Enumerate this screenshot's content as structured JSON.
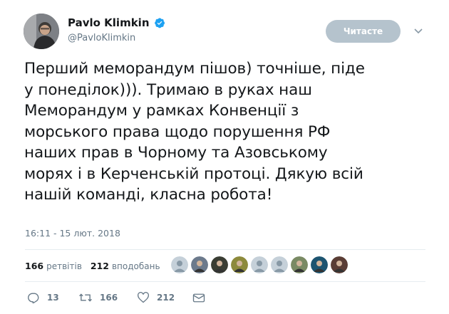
{
  "author": {
    "name": "Pavlo Klimkin",
    "handle": "@PavloKlimkin",
    "verified_icon": "verified-badge-icon"
  },
  "follow_button": {
    "label": "Читасте"
  },
  "tweet": {
    "text": "Перший меморандум пішов) точніше, піде\nу понеділок))). Тримаю в руках наш\nМеморандум у рамках Конвенції з\nморського права щодо порушення РФ\nнаших прав в Чорному та Азовському\nморях і в Керченській протоці. Дякую всій\nнашій команді, класна робота!",
    "timestamp": "16:11 - 15 лют. 2018"
  },
  "stats": {
    "retweets_count": "166",
    "retweets_label": "ретвітів",
    "likes_count": "212",
    "likes_label": "вподобань"
  },
  "likers": [
    {
      "kind": "default",
      "color": "#c5d0d9"
    },
    {
      "kind": "photo",
      "color": "#6c7a8c"
    },
    {
      "kind": "photo",
      "color": "#3a3d33"
    },
    {
      "kind": "photo",
      "color": "#8d8a3c"
    },
    {
      "kind": "default",
      "color": "#c5d0d9"
    },
    {
      "kind": "default",
      "color": "#c5d0d9"
    },
    {
      "kind": "photo",
      "color": "#7a8a64"
    },
    {
      "kind": "photo",
      "color": "#1d5470"
    },
    {
      "kind": "photo",
      "color": "#5a3d35"
    }
  ],
  "actions": {
    "reply_count": "13",
    "retweet_count": "166",
    "like_count": "212"
  },
  "colors": {
    "accent": "#1da1f2",
    "muted": "#657786",
    "follow_bg": "#b5c3cd"
  }
}
